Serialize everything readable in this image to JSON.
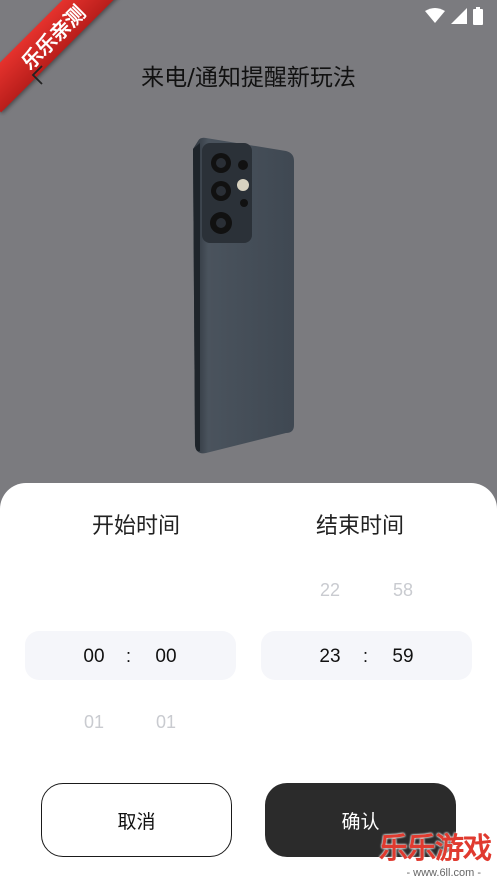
{
  "watermark": {
    "ribbon_text": "乐乐亲测",
    "logo_text": "乐乐游戏",
    "logo_sub": "- www.6ll.com -"
  },
  "header": {
    "title": "来电/通知提醒新玩法"
  },
  "sheet": {
    "start": {
      "title": "开始时间",
      "hour_selected": "00",
      "minute_selected": "00",
      "hour_next": "01",
      "minute_next": "01",
      "separator": ":"
    },
    "end": {
      "title": "结束时间",
      "hour_prev": "22",
      "minute_prev": "58",
      "hour_selected": "23",
      "minute_selected": "59",
      "separator": ":"
    },
    "buttons": {
      "cancel": "取消",
      "confirm": "确认"
    }
  },
  "icons": [
    "back-arrow-icon",
    "wifi-icon",
    "signal-icon",
    "battery-icon",
    "phone-render-image"
  ]
}
